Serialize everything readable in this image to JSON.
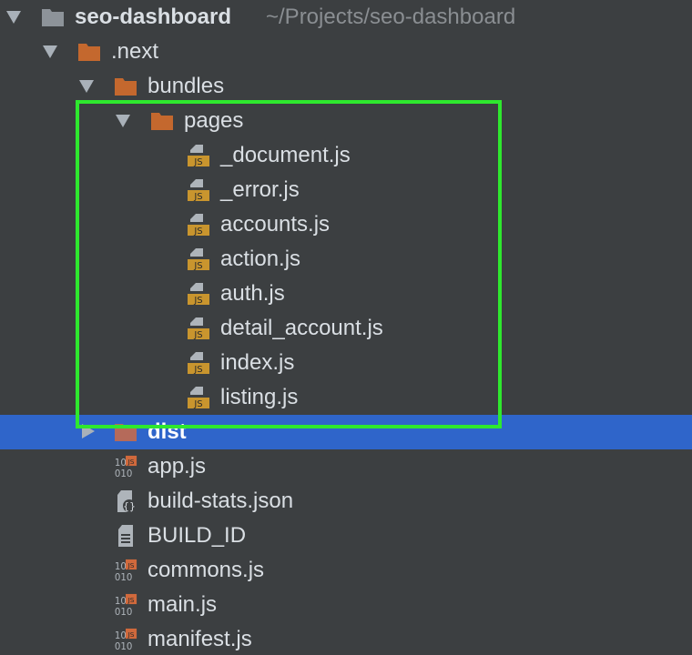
{
  "project": {
    "name": "seo-dashboard",
    "path": "~/Projects/seo-dashboard"
  },
  "tree": [
    {
      "label": ".next",
      "kind": "folder",
      "expanded": true
    },
    {
      "label": "bundles",
      "kind": "folder",
      "expanded": true
    },
    {
      "label": "pages",
      "kind": "folder",
      "expanded": true
    },
    {
      "label": "_document.js",
      "kind": "js-file"
    },
    {
      "label": "_error.js",
      "kind": "js-file"
    },
    {
      "label": "accounts.js",
      "kind": "js-file"
    },
    {
      "label": "action.js",
      "kind": "js-file"
    },
    {
      "label": "auth.js",
      "kind": "js-file"
    },
    {
      "label": "detail_account.js",
      "kind": "js-file"
    },
    {
      "label": "index.js",
      "kind": "js-file"
    },
    {
      "label": "listing.js",
      "kind": "js-file"
    },
    {
      "label": "dist",
      "kind": "folder",
      "expanded": false,
      "selected": true
    },
    {
      "label": "app.js",
      "kind": "js-binary-file"
    },
    {
      "label": "build-stats.json",
      "kind": "json-file"
    },
    {
      "label": "BUILD_ID",
      "kind": "text-file"
    },
    {
      "label": "commons.js",
      "kind": "js-binary-file"
    },
    {
      "label": "main.js",
      "kind": "js-binary-file"
    },
    {
      "label": "manifest.js",
      "kind": "js-binary-file"
    }
  ],
  "icons": {
    "folder": "folder-icon",
    "js-file": "javascript-file-icon",
    "js-binary-file": "javascript-binary-file-icon",
    "json-file": "json-file-icon",
    "text-file": "text-file-icon"
  },
  "colors": {
    "background": "#3c3f41",
    "selection": "#2f65ca",
    "folder": "#c4682e",
    "highlight_box": "#2ee82e",
    "text": "#dadfe4",
    "path_hint": "#8a8e92"
  }
}
